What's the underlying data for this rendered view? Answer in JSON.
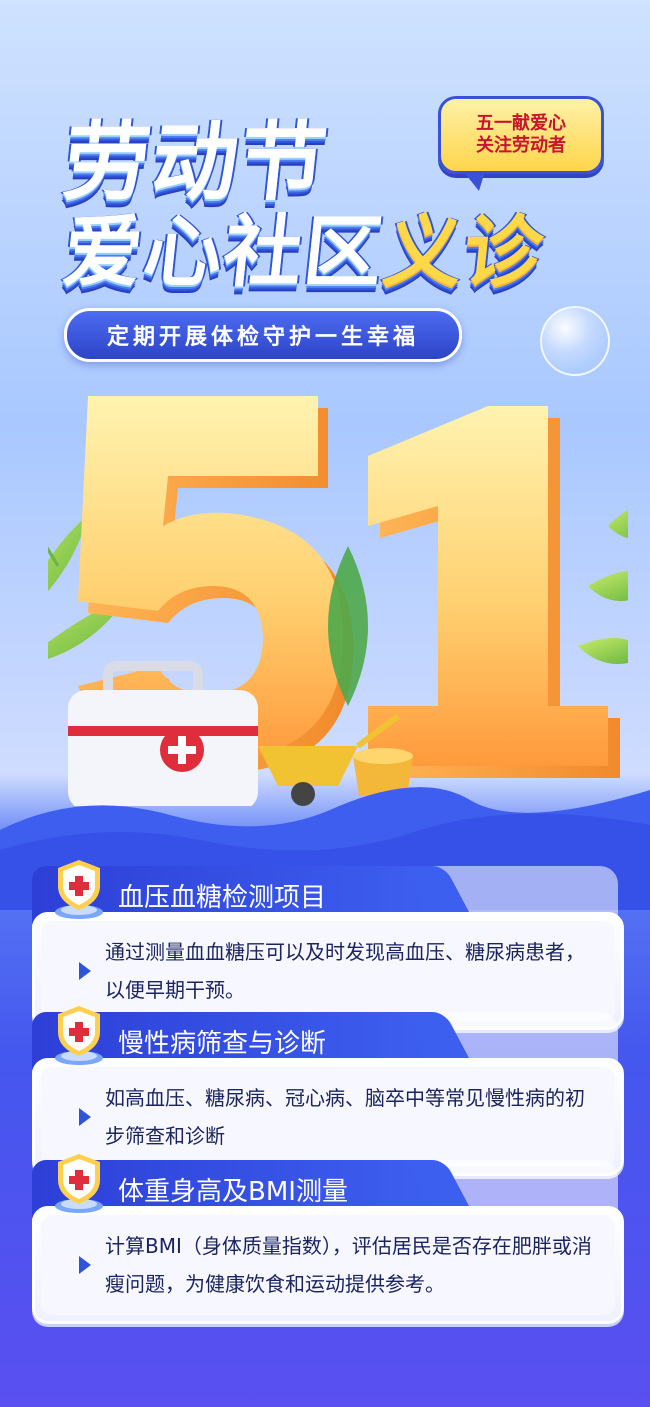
{
  "header": {
    "title_line1": "劳动节",
    "title_line2_main": "爱心社区",
    "title_line2_highlight": "义诊",
    "bubble_line1": "五一献爱心",
    "bubble_line2": "关注劳动者",
    "subtitle": "定期开展体检守护一生幸福"
  },
  "hero": {
    "number": "51"
  },
  "items": [
    {
      "title": "血压血糖检测项目",
      "desc": "通过测量血血糖压可以及时发现高血压、糖尿病患者，以便早期干预。"
    },
    {
      "title": "慢性病筛查与诊断",
      "desc": "如高血压、糖尿病、冠心病、脑卒中等常见慢性病的初步筛查和诊断"
    },
    {
      "title": "体重身高及BMI测量",
      "desc": "计算BMI（身体质量指数），评估居民是否存在肥胖或消瘦问题，为健康饮食和运动提供参考。"
    }
  ],
  "colors": {
    "primary_blue": "#3d5ff0",
    "accent_yellow": "#ffd84a",
    "accent_red": "#c8152e"
  }
}
